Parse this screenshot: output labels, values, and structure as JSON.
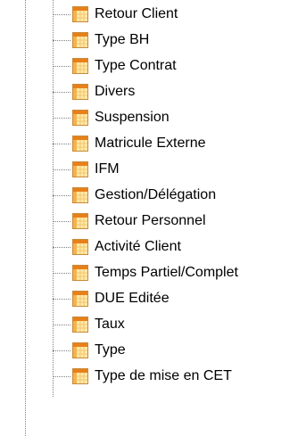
{
  "tree": {
    "items": [
      {
        "label": "Retour Client",
        "icon": "table-icon"
      },
      {
        "label": "Type BH",
        "icon": "table-icon"
      },
      {
        "label": "Type Contrat",
        "icon": "table-icon"
      },
      {
        "label": "Divers",
        "icon": "table-icon"
      },
      {
        "label": "Suspension",
        "icon": "table-icon"
      },
      {
        "label": "Matricule Externe",
        "icon": "table-icon"
      },
      {
        "label": "IFM",
        "icon": "table-icon"
      },
      {
        "label": "Gestion/Délégation",
        "icon": "table-icon"
      },
      {
        "label": "Retour Personnel",
        "icon": "table-icon"
      },
      {
        "label": "Activité Client",
        "icon": "table-icon"
      },
      {
        "label": "Temps Partiel/Complet",
        "icon": "table-icon"
      },
      {
        "label": "DUE Editée",
        "icon": "table-icon"
      },
      {
        "label": "Taux",
        "icon": "table-icon"
      },
      {
        "label": "Type",
        "icon": "table-icon"
      },
      {
        "label": "Type de mise en CET",
        "icon": "table-icon"
      }
    ]
  },
  "colors": {
    "guide_line": "#808080",
    "icon_header": "#e8801a",
    "icon_cell_light": "#fde9a9",
    "icon_cell_accent": "#f6b24a"
  }
}
